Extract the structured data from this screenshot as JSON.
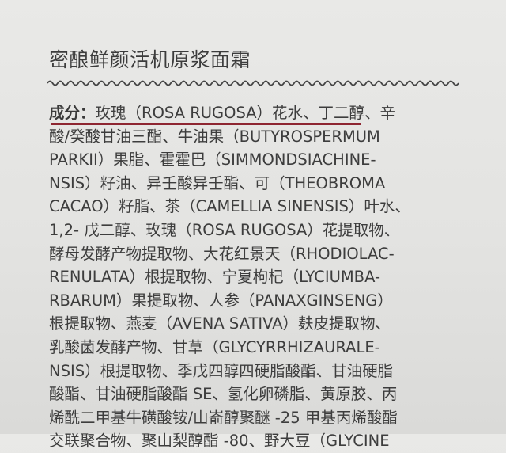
{
  "product": {
    "title": "密酿鲜颜活机原浆面霜"
  },
  "ingredients": {
    "heading": "成分：",
    "lines": [
      "玫瑰（ROSA RUGOSA）花水、丁二醇、辛",
      "酸/癸酸甘油三酯、牛油果（BUTYROSPERMUM",
      "PARKII）果脂、霍霍巴（SIMMONDSIACHINE-",
      "NSIS）籽油、异壬酸异壬酯、可（THEOBROMA",
      "CACAO）籽脂、茶（CAMELLIA SINENSIS）叶水、",
      "1,2- 戊二醇、玫瑰（ROSA RUGOSA）花提取物、",
      "酵母发酵产物提取物、大花红景天（RHODIOLAC-",
      "RENULATA）根提取物、宁夏枸杞（LYCIUMBA-",
      "RBARUM）果提取物、人参（PANAXGINSENG）",
      "根提取物、燕麦（AVENA SATIVA）麸皮提取物、",
      "乳酸菌发酵产物、甘草（GLYCYRRHIZAURALE-",
      "NSIS）根提取物、季戊四醇四硬脂酸酯、甘油硬脂",
      "酸酯、甘油硬脂酸酯 SE、氢化卵磷脂、黄原胶、丙",
      "烯酰二甲基牛磺酸铵/山嵛醇聚醚 -25 甲基丙烯酸酯",
      "交联聚合物、聚山梨醇酯 -80、野大豆（GLYCINE"
    ]
  },
  "colors": {
    "accent_underline": "#8e2631",
    "text": "#3d3d3d",
    "background": "#e6e6e4"
  }
}
